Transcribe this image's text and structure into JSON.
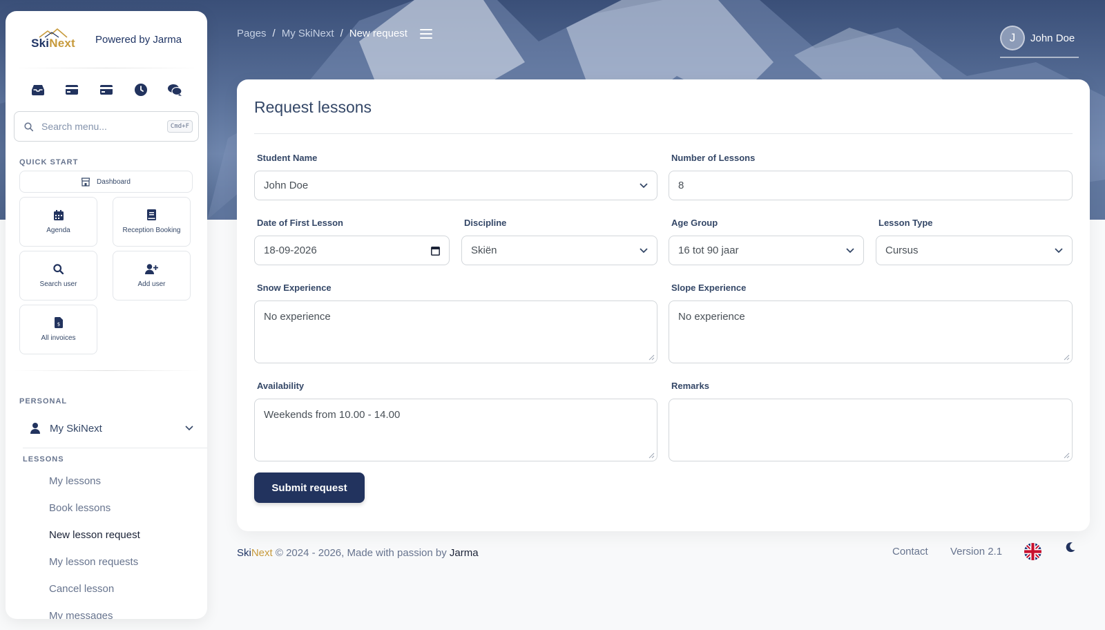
{
  "brand": {
    "logo_ski": "Ski",
    "logo_next": "Next",
    "powered_by": "Powered by Jarma",
    "accent_navy": "#22335e",
    "accent_gold": "#c79a3c"
  },
  "sidebar": {
    "top_icons": [
      "inbox-icon",
      "credit-card-icon",
      "credit-card-icon",
      "clock-icon",
      "chat-icon"
    ],
    "search": {
      "placeholder": "Search menu...",
      "shortcut": "Cmd+F"
    },
    "quick_start": {
      "title": "QUICK START",
      "dashboard": "Dashboard",
      "cards": [
        {
          "label": "Agenda",
          "icon": "calendar-icon"
        },
        {
          "label": "Reception Booking",
          "icon": "book-icon"
        },
        {
          "label": "Search user",
          "icon": "search-icon"
        },
        {
          "label": "Add user",
          "icon": "user-plus-icon"
        },
        {
          "label": "All invoices",
          "icon": "invoice-icon"
        }
      ]
    },
    "personal": {
      "title": "PERSONAL",
      "item": "My SkiNext"
    },
    "lessons": {
      "title": "LESSONS",
      "items": [
        "My lessons",
        "Book lessons",
        "New lesson request",
        "My lesson requests",
        "Cancel lesson",
        "My messages"
      ],
      "active_index": 2
    }
  },
  "topbar": {
    "breadcrumb": [
      "Pages",
      "My SkiNext",
      "New request"
    ],
    "user_initial": "J",
    "user_name": "John Doe"
  },
  "form": {
    "title": "Request lessons",
    "student_name": {
      "label": "Student Name",
      "value": "John Doe"
    },
    "number_of_lessons": {
      "label": "Number of Lessons",
      "value": "8"
    },
    "date_first_lesson": {
      "label": "Date of First Lesson",
      "value": "18-09-2026"
    },
    "discipline": {
      "label": "Discipline",
      "value": "Skiën"
    },
    "age_group": {
      "label": "Age Group",
      "value": "16 tot 90 jaar"
    },
    "lesson_type": {
      "label": "Lesson Type",
      "value": "Cursus"
    },
    "snow_experience": {
      "label": "Snow Experience",
      "value": "No experience"
    },
    "slope_experience": {
      "label": "Slope Experience",
      "value": "No experience"
    },
    "availability": {
      "label": "Availability",
      "value": "Weekends from 10.00 - 14.00"
    },
    "remarks": {
      "label": "Remarks",
      "value": ""
    },
    "submit_label": "Submit request"
  },
  "footer": {
    "brand_ski": "Ski",
    "brand_next": "Next",
    "copyright": " © 2024 - 2026, Made with passion by ",
    "company": "Jarma",
    "contact": "Contact",
    "version": "Version 2.1",
    "language_icon": "uk-flag-icon",
    "theme_icon": "moon-icon"
  }
}
